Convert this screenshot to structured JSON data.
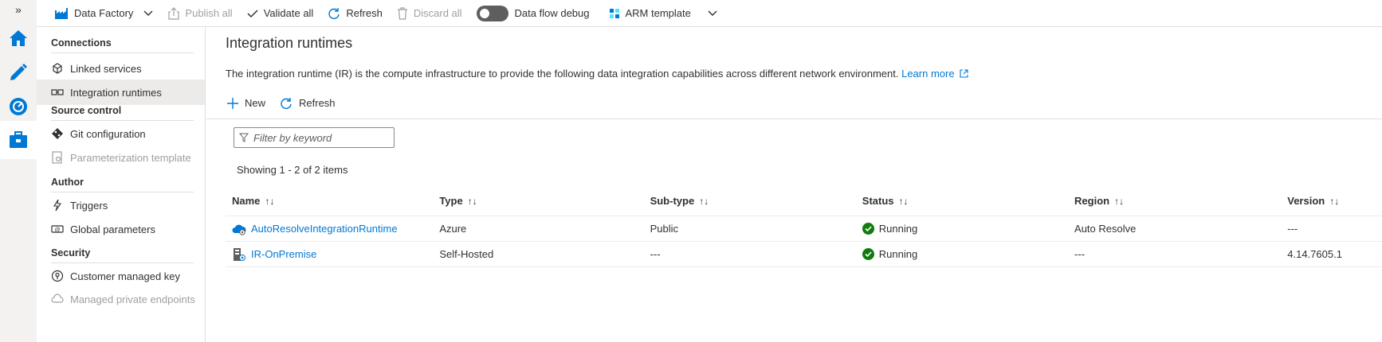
{
  "rail": {
    "toggle_glyph": "»",
    "items": [
      {
        "name": "home",
        "icon": "home-icon"
      },
      {
        "name": "author",
        "icon": "pencil-icon"
      },
      {
        "name": "monitor",
        "icon": "monitor-gauge-icon"
      },
      {
        "name": "manage",
        "icon": "toolbox-icon"
      }
    ]
  },
  "toolbar": {
    "factory_label": "Data Factory",
    "publish_label": "Publish all",
    "validate_label": "Validate all",
    "refresh_label": "Refresh",
    "discard_label": "Discard all",
    "debug_label": "Data flow debug",
    "debug_on": false,
    "arm_label": "ARM template"
  },
  "nav": {
    "connections": {
      "heading": "Connections",
      "items": [
        {
          "label": "Linked services",
          "icon": "linked-services-icon",
          "active": false,
          "disabled": false
        },
        {
          "label": "Integration runtimes",
          "icon": "integration-runtime-icon",
          "active": true,
          "disabled": false
        }
      ]
    },
    "source_control": {
      "heading": "Source control",
      "items": [
        {
          "label": "Git configuration",
          "icon": "git-icon",
          "active": false,
          "disabled": false
        },
        {
          "label": "Parameterization template",
          "icon": "template-icon",
          "active": false,
          "disabled": true
        }
      ]
    },
    "author": {
      "heading": "Author",
      "items": [
        {
          "label": "Triggers",
          "icon": "lightning-icon",
          "active": false,
          "disabled": false
        },
        {
          "label": "Global parameters",
          "icon": "parameters-icon",
          "active": false,
          "disabled": false
        }
      ]
    },
    "security": {
      "heading": "Security",
      "items": [
        {
          "label": "Customer managed key",
          "icon": "lock-key-icon",
          "active": false,
          "disabled": false
        },
        {
          "label": "Managed private endpoints",
          "icon": "cloud-link-icon",
          "active": false,
          "disabled": true
        }
      ]
    }
  },
  "main": {
    "title": "Integration runtimes",
    "description": "The integration runtime (IR) is the compute infrastructure to provide the following data integration capabilities across different network environment.",
    "learn_more": "Learn more",
    "new_label": "New",
    "refresh_label": "Refresh",
    "filter_placeholder": "Filter by keyword",
    "showing": "Showing 1 - 2 of 2 items",
    "columns": [
      "Name",
      "Type",
      "Sub-type",
      "Status",
      "Region",
      "Version"
    ],
    "sort_glyph": "↑↓",
    "rows": [
      {
        "name": "AutoResolveIntegrationRuntime",
        "icon": "cloud-runtime-icon",
        "type": "Azure",
        "subtype": "Public",
        "status": "Running",
        "region": "Auto Resolve",
        "version": "---"
      },
      {
        "name": "IR-OnPremise",
        "icon": "server-runtime-icon",
        "type": "Self-Hosted",
        "subtype": "---",
        "status": "Running",
        "region": "---",
        "version": "4.14.7605.1"
      }
    ]
  },
  "colors": {
    "accent": "#0078d4",
    "running": "#107c10",
    "rail_bg": "#f3f2f1",
    "nav_active_bg": "#edebe9"
  }
}
